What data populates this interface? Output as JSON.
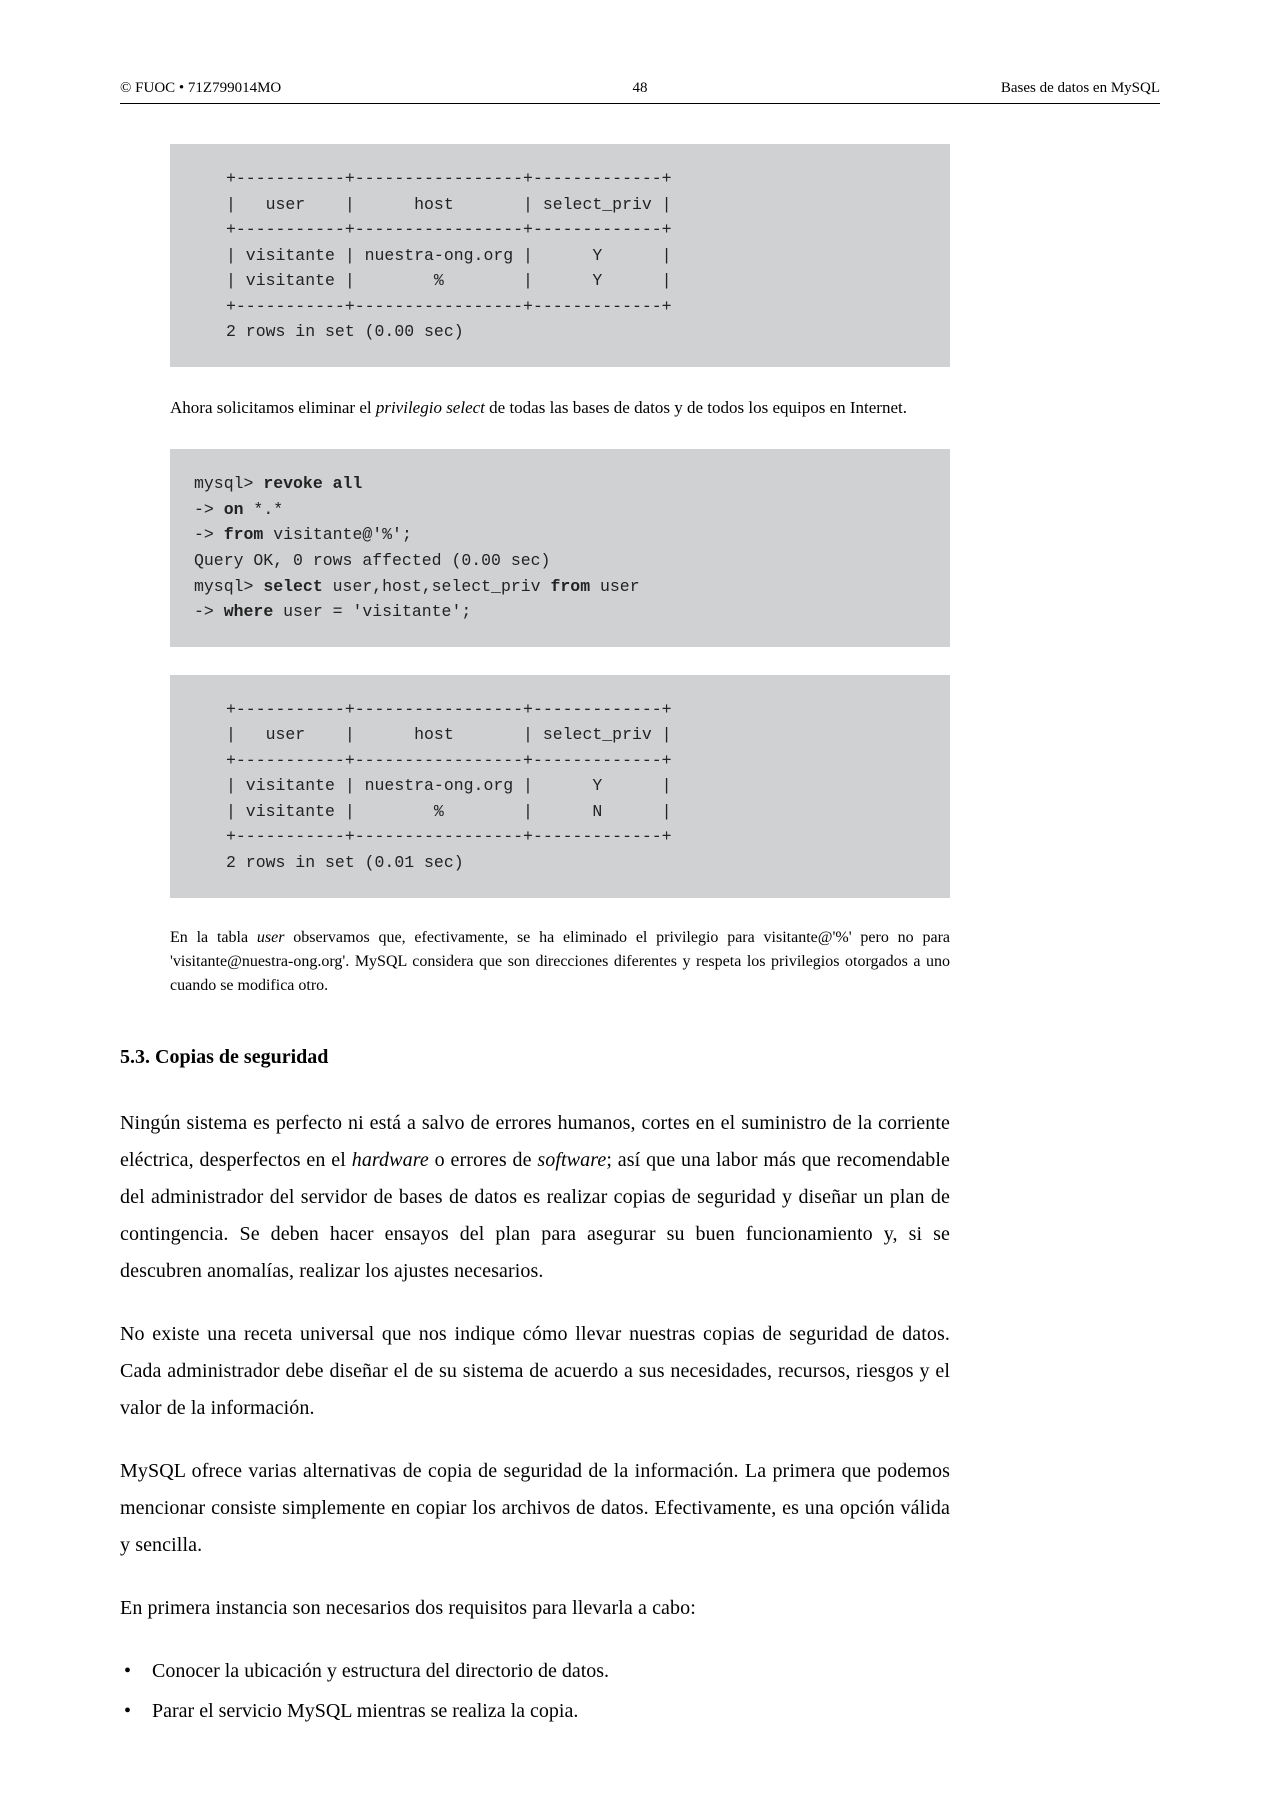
{
  "header": {
    "left": "© FUOC • 71Z799014MO",
    "center": "48",
    "right": "Bases de datos en MySQL"
  },
  "code1": {
    "l1": "+-----------+-----------------+-------------+",
    "l2": "|   user    |      host       | select_priv |",
    "l3": "+-----------+-----------------+-------------+",
    "l4": "| visitante | nuestra-ong.org |      Y      |",
    "l5": "| visitante |        %        |      Y      |",
    "l6": "+-----------+-----------------+-------------+",
    "l7": "2 rows in set (0.00 sec)"
  },
  "para1": {
    "a": "Ahora solicitamos eliminar el ",
    "b": "privilegio select",
    "c": " de todas las bases de datos y de todos los equipos en Internet."
  },
  "code2": {
    "l1a": "mysql> ",
    "l1b": "revoke all",
    "l2a": "-> ",
    "l2b": "on",
    "l2c": " *.*",
    "l3a": "-> ",
    "l3b": "from",
    "l3c": " visitante@'%';",
    "l4": "Query OK, 0 rows affected (0.00 sec)",
    "l5a": "mysql> ",
    "l5b": "select",
    "l5c": " user,host,select_priv ",
    "l5d": "from",
    "l5e": " user",
    "l6a": "-> ",
    "l6b": "where",
    "l6c": " user = 'visitante';"
  },
  "code3": {
    "l1": "+-----------+-----------------+-------------+",
    "l2": "|   user    |      host       | select_priv |",
    "l3": "+-----------+-----------------+-------------+",
    "l4": "| visitante | nuestra-ong.org |      Y      |",
    "l5": "| visitante |        %        |      N      |",
    "l6": "+-----------+-----------------+-------------+",
    "l7": "2 rows in set (0.01 sec)"
  },
  "para2": {
    "a": "En la tabla ",
    "b": "user",
    "c": " observamos que, efectivamente, se ha eliminado el privilegio para visitante@'%' pero no para 'visitante@nuestra-ong.org'. MySQL considera que son direcciones diferentes y respeta los privilegios otorgados a uno cuando se modifica otro."
  },
  "heading": "5.3.  Copias de seguridad",
  "body1": {
    "a": "Ningún sistema es perfecto ni está a salvo de errores humanos, cortes en el suministro de la corriente eléctrica, desperfectos en el ",
    "b": "hardware",
    "c": " o errores de ",
    "d": "software",
    "e": "; así que una labor más que recomendable del administrador del servidor de bases de datos es realizar copias de seguridad y diseñar un plan de contingencia. Se deben hacer ensayos del plan para asegurar su buen funcionamiento y, si se descubren anomalías, realizar los ajustes necesarios."
  },
  "body2": "No existe una receta universal que nos indique cómo llevar nuestras copias de seguridad de datos. Cada administrador debe diseñar el de su sistema de acuerdo a sus necesidades, recursos, riesgos y el valor de la información.",
  "body3": "MySQL ofrece varias alternativas de copia de seguridad de la información. La primera que podemos mencionar consiste simplemente en copiar los archivos de datos. Efectivamente, es una opción válida y sencilla.",
  "body4": "En primera instancia son necesarios dos requisitos para llevarla a cabo:",
  "bullets": {
    "b1": "Conocer la ubicación y estructura del directorio de datos.",
    "b2": "Parar el servicio MySQL mientras se realiza la copia."
  }
}
